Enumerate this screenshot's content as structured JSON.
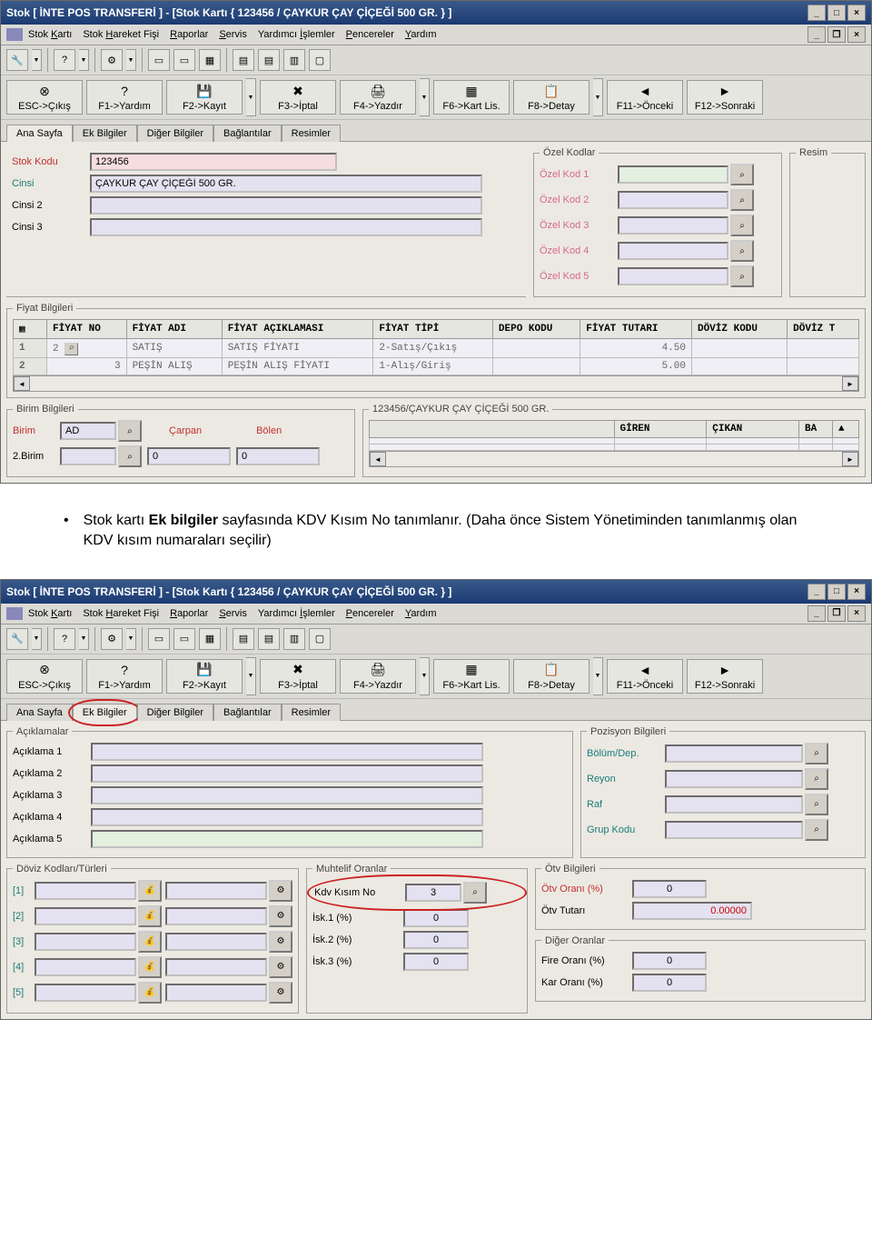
{
  "window_title": "Stok [ İNTE POS TRANSFERİ ]  - [Stok Kartı { 123456 / ÇAYKUR ÇAY ÇİÇEĞİ 500 GR. } ]",
  "menu": [
    "Stok Kartı",
    "Stok Hareket Fişi",
    "Raporlar",
    "Servis",
    "Yardımcı İşlemler",
    "Pencereler",
    "Yardım"
  ],
  "menu_ul": [
    "K",
    "H",
    "R",
    "S",
    "İ",
    "P",
    "Y"
  ],
  "toolbar": {
    "esc": "ESC->Çıkış",
    "f1": "F1->Yardım",
    "f2": "F2->Kayıt",
    "f3": "F3->İptal",
    "f4": "F4->Yazdır",
    "f6": "F6->Kart Lis.",
    "f8": "F8->Detay",
    "f11": "F11->Önceki",
    "f12": "F12->Sonraki"
  },
  "tabs": [
    "Ana Sayfa",
    "Ek Bilgiler",
    "Diğer Bilgiler",
    "Bağlantılar",
    "Resimler"
  ],
  "main1": {
    "stok_kodu_lbl": "Stok Kodu",
    "stok_kodu": "123456",
    "cinsi_lbl": "Cinsi",
    "cinsi": "ÇAYKUR ÇAY ÇİÇEĞİ 500 GR.",
    "cinsi2_lbl": "Cinsi 2",
    "cinsi2": "",
    "cinsi3_lbl": "Cinsi 3",
    "cinsi3": "",
    "ozel_kodlar": "Özel Kodlar",
    "ok1": "Özel Kod 1",
    "ok2": "Özel Kod 2",
    "ok3": "Özel Kod 3",
    "ok4": "Özel Kod 4",
    "ok5": "Özel Kod 5",
    "resim": "Resim"
  },
  "fiyat": {
    "legend": "Fiyat Bilgileri",
    "cols": [
      "FİYAT NO",
      "FİYAT ADI",
      "FİYAT AÇIKLAMASI",
      "FİYAT TİPİ",
      "DEPO KODU",
      "FİYAT TUTARI",
      "DÖVİZ KODU",
      "DÖVİZ T"
    ],
    "rows": [
      {
        "rn": "1",
        "no": "2",
        "ad": "SATIŞ",
        "acik": "SATIŞ FİYATI",
        "tip": "2-Satış/Çıkış",
        "depo": "",
        "tutar": "4.50",
        "doviz": ""
      },
      {
        "rn": "2",
        "no": "3",
        "ad": "PEŞİN ALIŞ",
        "acik": "PEŞİN ALIŞ FİYATI",
        "tip": "1-Alış/Giriş",
        "depo": "",
        "tutar": "5.00",
        "doviz": ""
      }
    ]
  },
  "birim": {
    "legend": "Birim Bilgileri",
    "birim_lbl": "Birim",
    "birim": "AD",
    "carpan_lbl": "Çarpan",
    "bolen_lbl": "Bölen",
    "birim2_lbl": "2.Birim",
    "carpan2": "0",
    "bolen2": "0"
  },
  "stok_hareket": {
    "header": "123456/ÇAYKUR ÇAY ÇİÇEĞİ 500 GR.",
    "cols": [
      "GİREN",
      "ÇIKAN",
      "BA"
    ]
  },
  "instruction_html": "Stok kartı <b>Ek bilgiler</b> sayfasında KDV Kısım No tanımlanır.  (Daha önce Sistem Yönetiminden tanımlanmış olan KDV kısım numaraları seçilir)",
  "win2": {
    "aciklamalar": "Açıklamalar",
    "a1": "Açıklama 1",
    "a2": "Açıklama 2",
    "a3": "Açıklama 3",
    "a4": "Açıklama 4",
    "a5": "Açıklama 5",
    "pozisyon": "Pozisyon Bilgileri",
    "bolum": "Bölüm/Dep.",
    "reyon": "Reyon",
    "raf": "Raf",
    "grup": "Grup Kodu",
    "doviz": "Döviz Kodları/Türleri",
    "d1": "[1]",
    "d2": "[2]",
    "d3": "[3]",
    "d4": "[4]",
    "d5": "[5]",
    "muhtelif": "Muhtelif Oranlar",
    "kdv_lbl": "Kdv Kısım No",
    "kdv": "3",
    "isk1_lbl": "İsk.1 (%)",
    "isk1": "0",
    "isk2_lbl": "İsk.2  (%)",
    "isk2": "0",
    "isk3_lbl": "İsk.3  (%)",
    "isk3": "0",
    "otv": "Ötv Bilgileri",
    "otv_oran_lbl": "Ötv Oranı (%)",
    "otv_oran": "0",
    "otv_tutar_lbl": "Ötv Tutarı",
    "otv_tutar": "0.00000",
    "diger": "Diğer Oranlar",
    "fire_lbl": "Fire Oranı (%)",
    "fire": "0",
    "kar_lbl": "Kar Oranı  (%)",
    "kar": "0"
  }
}
